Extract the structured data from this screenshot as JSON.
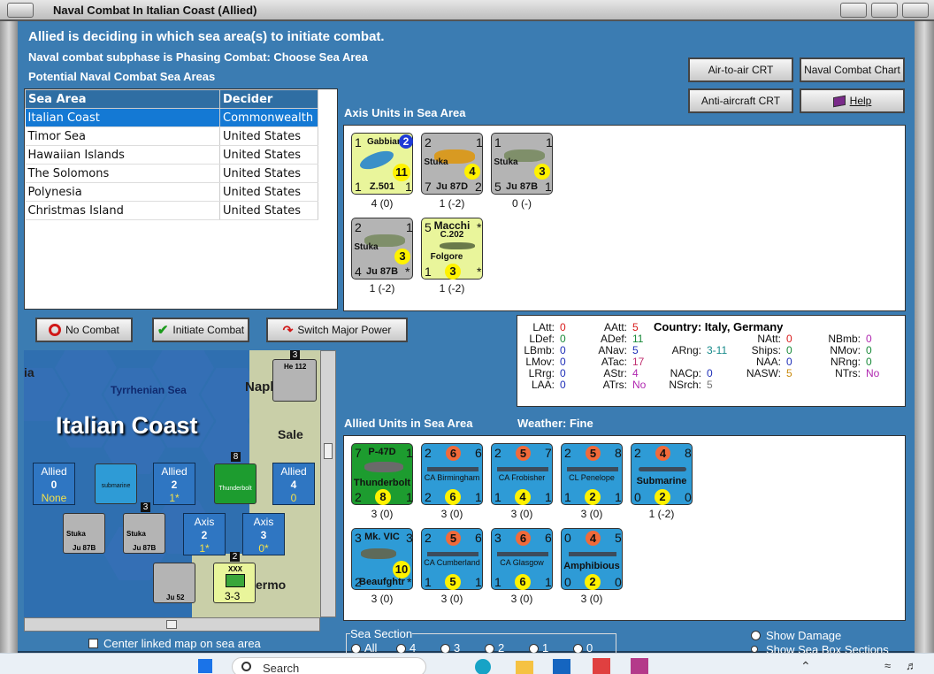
{
  "window": {
    "title": "Naval Combat In Italian Coast (Allied)"
  },
  "header": {
    "line1": "Allied is deciding in which sea area(s) to initiate combat.",
    "line2": "Naval combat subphase is Phasing Combat: Choose Sea Area",
    "line3": "Potential Naval Combat Sea Areas"
  },
  "buttons": {
    "air_to_air": "Air-to-air CRT",
    "naval_chart": "Naval Combat Chart",
    "anti_aircraft": "Anti-aircraft CRT",
    "help": "Help",
    "no_combat": "No Combat",
    "initiate": "Initiate Combat",
    "switch_power": "Switch Major Power"
  },
  "sea_table": {
    "col1": "Sea Area",
    "col2": "Decider",
    "rows": [
      {
        "area": "Italian Coast",
        "decider": "Commonwealth"
      },
      {
        "area": "Timor Sea",
        "decider": "United States"
      },
      {
        "area": "Hawaiian Islands",
        "decider": "United States"
      },
      {
        "area": "The Solomons",
        "decider": "United States"
      },
      {
        "area": "Polynesia",
        "decider": "United States"
      },
      {
        "area": "Christmas Island",
        "decider": "United States"
      }
    ]
  },
  "axis": {
    "title": "Axis Units in Sea Area",
    "units": [
      {
        "tl": "1",
        "tr": "2",
        "name": "Gabbiano",
        "big": "11",
        "bl": "1",
        "type": "Z.501",
        "br": "1",
        "sub": "4 (0)"
      },
      {
        "tl": "2",
        "tr": "1",
        "name": "Stuka",
        "big": "4",
        "bl": "7",
        "type": "Ju 87D",
        "br": "2",
        "sub": "1 (-2)"
      },
      {
        "tl": "1",
        "tr": "1",
        "name": "Stuka",
        "big": "3",
        "bl": "5",
        "type": "Ju 87B",
        "br": "1",
        "sub": "0 (-)"
      },
      {
        "tl": "2",
        "tr": "1",
        "name": "Stuka",
        "big": "3",
        "bl": "4",
        "type": "Ju 87B",
        "br": "*",
        "sub": "1 (-2)"
      },
      {
        "tl": "5",
        "tr": "*",
        "name": "Macchi",
        "name2": "C.202",
        "name3": "Folgore",
        "big": "3",
        "bl": "1",
        "br": "*",
        "sub": "1 (-2)"
      }
    ]
  },
  "stats": {
    "latt_l": "LAtt:",
    "latt": "0",
    "ldef_l": "LDef:",
    "ldef": "0",
    "lbmb_l": "LBmb:",
    "lbmb": "0",
    "lmov_l": "LMov:",
    "lmov": "0",
    "lrng_l": "LRrg:",
    "lrng": "0",
    "laa_l": "LAA:",
    "laa": "0",
    "aatt_l": "AAtt:",
    "aatt": "5",
    "adef_l": "ADef:",
    "adef": "11",
    "anav_l": "ANav:",
    "anav": "5",
    "atac_l": "ATac:",
    "atac": "17",
    "astr_l": "AStr:",
    "astr": "4",
    "atrs_l": "ATrs:",
    "atrs": "No",
    "country": "Country: Italy, Germany",
    "arng_l": "ARng:",
    "arng": "3-11",
    "nacp_l": "NACp:",
    "nacp": "0",
    "nsrch_l": "NSrch:",
    "nsrch": "5",
    "natt_l": "NAtt:",
    "natt": "0",
    "ships_l": "Ships:",
    "ships": "0",
    "naa_l": "NAA:",
    "naa": "0",
    "nasw_l": "NASW:",
    "nasw": "5",
    "nbmb_l": "NBmb:",
    "nbmb": "0",
    "nmov_l": "NMov:",
    "nmov": "0",
    "nrng_l": "NRng:",
    "nrng": "0",
    "ntrs_l": "NTrs:",
    "ntrs": "No"
  },
  "allied": {
    "title": "Allied Units in Sea Area",
    "weather": "Weather:  Fine",
    "units": [
      {
        "tl": "7",
        "name": "P-47D",
        "tr": "1",
        "name2": "Thunderbolt",
        "bl": "2",
        "big": "8",
        "br": "1",
        "sub": "3 (0)"
      },
      {
        "tl": "2",
        "top": "6",
        "tr": "6",
        "name": "CA Birmingham",
        "bl": "2",
        "big": "6",
        "br": "1",
        "sub": "3 (0)"
      },
      {
        "tl": "2",
        "top": "5",
        "tr": "7",
        "name": "CA Frobisher",
        "bl": "1",
        "big": "4",
        "br": "1",
        "sub": "3 (0)"
      },
      {
        "tl": "2",
        "top": "5",
        "tr": "8",
        "name": "CL Penelope",
        "bl": "1",
        "big": "2",
        "br": "1",
        "sub": "3 (0)"
      },
      {
        "tl": "2",
        "top": "4",
        "tr": "8",
        "name": "Submarine",
        "bl": "0",
        "big": "2",
        "br": "0",
        "sub": "1 (-2)"
      },
      {
        "tl": "3",
        "name": "Mk. VIC",
        "tr": "3",
        "name2": "Beaufghtr",
        "bl": "2",
        "big": "10",
        "br": "*",
        "sub": "3 (0)"
      },
      {
        "tl": "2",
        "top": "5",
        "tr": "6",
        "name": "CA Cumberland",
        "bl": "1",
        "big": "5",
        "br": "1",
        "sub": "3 (0)"
      },
      {
        "tl": "3",
        "top": "6",
        "tr": "6",
        "name": "CA Glasgow",
        "bl": "1",
        "big": "6",
        "br": "1",
        "sub": "3 (0)"
      },
      {
        "tl": "0",
        "top": "4",
        "tr": "5",
        "name": "Amphibious",
        "bl": "0",
        "big": "2",
        "br": "0",
        "sub": "3 (0)"
      }
    ]
  },
  "map": {
    "sea_name": "Tyrrhenian Sea",
    "area_name": "Italian Coast",
    "napl": "Napl",
    "sale": "Sale",
    "ermo": "ermo",
    "ia": "ia",
    "allied1": "Allied",
    "allied1_n": "0",
    "allied1_s": "None",
    "allied2": "Allied",
    "allied2_n": "2",
    "allied2_s": "1*",
    "allied3": "Allied",
    "allied3_n": "4",
    "allied3_s": "0",
    "axis1": "Axis",
    "axis1_n": "2",
    "axis1_s": "1*",
    "axis2": "Axis",
    "axis2_n": "3",
    "axis2_s": "0*",
    "he112": "He 112",
    "ju52": "Ju 52",
    "xxx": "XXX",
    "b33": "3-3",
    "sub_lbl": "submarine",
    "thb_lbl": "Thunderbolt",
    "stuka": "Stuka",
    "ju87b": "Ju 87B",
    "stack3": "3",
    "stack8": "8",
    "stack2": "2"
  },
  "footer": {
    "center_map": "Center linked map on sea area",
    "sea_section": "Sea Section",
    "opt_all": "All",
    "opt4": "4",
    "opt3": "3",
    "opt2": "2",
    "opt1": "1",
    "opt0": "0",
    "show_damage": "Show Damage",
    "show_sea_box": "Show Sea Box Sections"
  },
  "taskbar": {
    "search": "Search"
  }
}
